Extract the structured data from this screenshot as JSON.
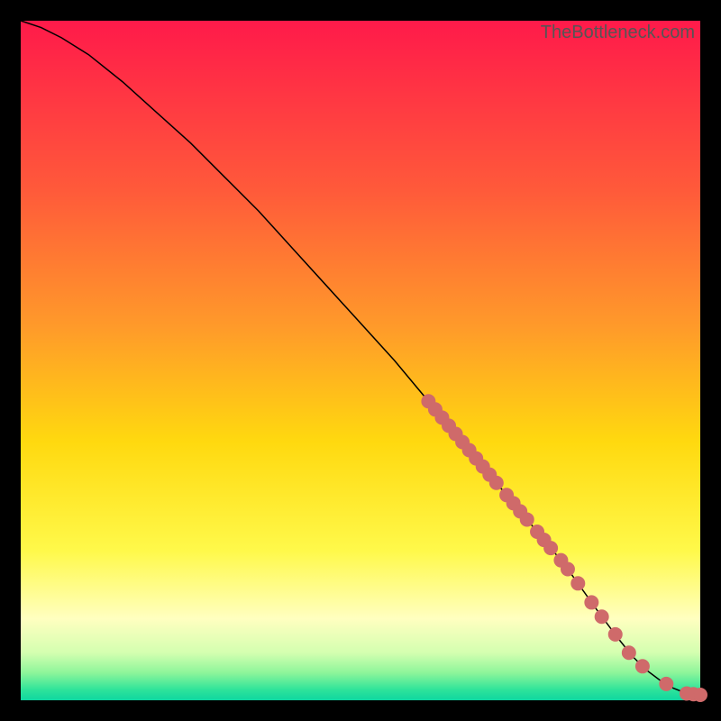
{
  "attribution": "TheBottleneck.com",
  "gradient_stops": [
    {
      "pct": 0,
      "color": "#ff1a4a"
    },
    {
      "pct": 25,
      "color": "#ff5a3a"
    },
    {
      "pct": 45,
      "color": "#ff9a2a"
    },
    {
      "pct": 62,
      "color": "#ffd90f"
    },
    {
      "pct": 78,
      "color": "#fff94a"
    },
    {
      "pct": 88,
      "color": "#ffffc0"
    },
    {
      "pct": 93,
      "color": "#d4ffb0"
    },
    {
      "pct": 96,
      "color": "#8cf59a"
    },
    {
      "pct": 98.5,
      "color": "#2de39a"
    },
    {
      "pct": 100,
      "color": "#0fd6a0"
    }
  ],
  "chart_data": {
    "type": "line",
    "title": "",
    "xlabel": "",
    "ylabel": "",
    "xlim": [
      0,
      100
    ],
    "ylim": [
      0,
      100
    ],
    "series": [
      {
        "name": "curve",
        "x": [
          0,
          3,
          6,
          10,
          15,
          20,
          25,
          30,
          35,
          40,
          45,
          50,
          55,
          60,
          65,
          70,
          75,
          80,
          85,
          88,
          90,
          92,
          94,
          96,
          98,
          100
        ],
        "y": [
          100,
          99,
          97.5,
          95,
          91,
          86.5,
          82,
          77,
          72,
          66.5,
          61,
          55.5,
          50,
          44,
          38,
          32,
          26,
          20,
          13,
          9,
          6.5,
          4.5,
          3,
          1.8,
          1,
          0.8
        ]
      }
    ],
    "markers": [
      {
        "x": 60.0,
        "y": 44.0
      },
      {
        "x": 61.0,
        "y": 42.8
      },
      {
        "x": 62.0,
        "y": 41.6
      },
      {
        "x": 63.0,
        "y": 40.4
      },
      {
        "x": 64.0,
        "y": 39.2
      },
      {
        "x": 65.0,
        "y": 38.0
      },
      {
        "x": 66.0,
        "y": 36.8
      },
      {
        "x": 67.0,
        "y": 35.6
      },
      {
        "x": 68.0,
        "y": 34.4
      },
      {
        "x": 69.0,
        "y": 33.2
      },
      {
        "x": 70.0,
        "y": 32.0
      },
      {
        "x": 71.5,
        "y": 30.2
      },
      {
        "x": 72.5,
        "y": 29.0
      },
      {
        "x": 73.5,
        "y": 27.8
      },
      {
        "x": 74.5,
        "y": 26.6
      },
      {
        "x": 76.0,
        "y": 24.8
      },
      {
        "x": 77.0,
        "y": 23.6
      },
      {
        "x": 78.0,
        "y": 22.4
      },
      {
        "x": 79.5,
        "y": 20.6
      },
      {
        "x": 80.5,
        "y": 19.3
      },
      {
        "x": 82.0,
        "y": 17.2
      },
      {
        "x": 84.0,
        "y": 14.4
      },
      {
        "x": 85.5,
        "y": 12.3
      },
      {
        "x": 87.5,
        "y": 9.7
      },
      {
        "x": 89.5,
        "y": 7.0
      },
      {
        "x": 91.5,
        "y": 5.0
      },
      {
        "x": 95.0,
        "y": 2.4
      },
      {
        "x": 98.0,
        "y": 1.0
      },
      {
        "x": 99.0,
        "y": 0.9
      },
      {
        "x": 100.0,
        "y": 0.8
      }
    ]
  }
}
